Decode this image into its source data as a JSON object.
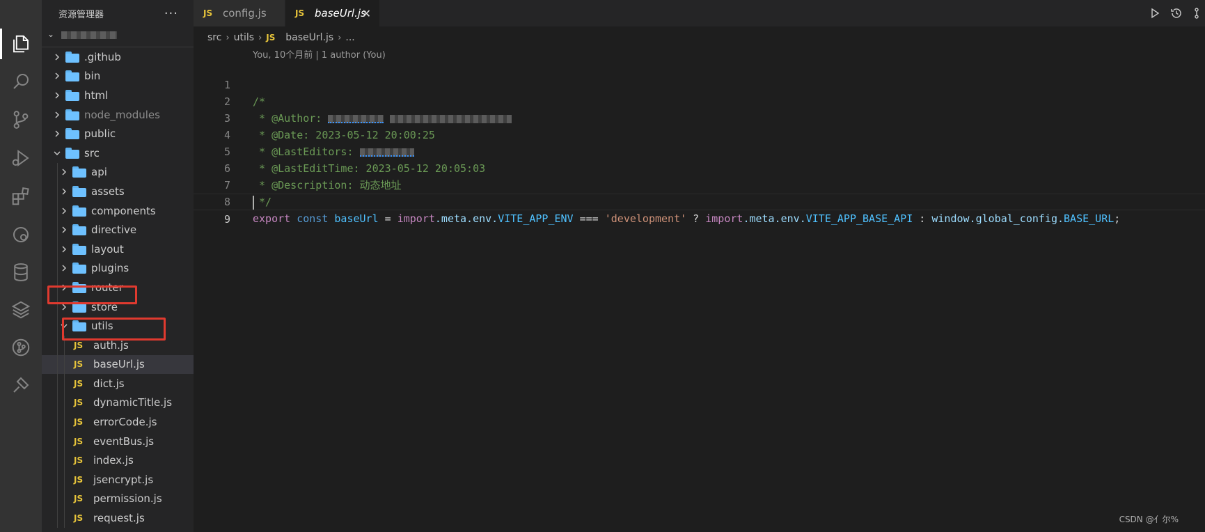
{
  "sidebar": {
    "title": "资源管理器",
    "more": "···",
    "items": [
      {
        "type": "folder",
        "label": ".github",
        "depth": 1,
        "open": false
      },
      {
        "type": "folder",
        "label": "bin",
        "depth": 1,
        "open": false
      },
      {
        "type": "folder",
        "label": "html",
        "depth": 1,
        "open": false
      },
      {
        "type": "folder",
        "label": "node_modules",
        "depth": 1,
        "open": false,
        "dim": true
      },
      {
        "type": "folder",
        "label": "public",
        "depth": 1,
        "open": false
      },
      {
        "type": "folder",
        "label": "src",
        "depth": 1,
        "open": true
      },
      {
        "type": "folder",
        "label": "api",
        "depth": 2,
        "open": false
      },
      {
        "type": "folder",
        "label": "assets",
        "depth": 2,
        "open": false
      },
      {
        "type": "folder",
        "label": "components",
        "depth": 2,
        "open": false
      },
      {
        "type": "folder",
        "label": "directive",
        "depth": 2,
        "open": false
      },
      {
        "type": "folder",
        "label": "layout",
        "depth": 2,
        "open": false
      },
      {
        "type": "folder",
        "label": "plugins",
        "depth": 2,
        "open": false
      },
      {
        "type": "folder",
        "label": "router",
        "depth": 2,
        "open": false
      },
      {
        "type": "folder",
        "label": "store",
        "depth": 2,
        "open": false
      },
      {
        "type": "folder",
        "label": "utils",
        "depth": 2,
        "open": true,
        "highlighted": true
      },
      {
        "type": "file",
        "label": "auth.js",
        "depth": 3
      },
      {
        "type": "file",
        "label": "baseUrl.js",
        "depth": 3,
        "selected": true,
        "highlighted": true
      },
      {
        "type": "file",
        "label": "dict.js",
        "depth": 3
      },
      {
        "type": "file",
        "label": "dynamicTitle.js",
        "depth": 3
      },
      {
        "type": "file",
        "label": "errorCode.js",
        "depth": 3
      },
      {
        "type": "file",
        "label": "eventBus.js",
        "depth": 3
      },
      {
        "type": "file",
        "label": "index.js",
        "depth": 3
      },
      {
        "type": "file",
        "label": "jsencrypt.js",
        "depth": 3
      },
      {
        "type": "file",
        "label": "permission.js",
        "depth": 3
      },
      {
        "type": "file",
        "label": "request.js",
        "depth": 3
      }
    ]
  },
  "tabs": [
    {
      "icon": "JS",
      "label": "config.js",
      "active": false
    },
    {
      "icon": "JS",
      "label": "baseUrl.js",
      "active": true,
      "close": "✕"
    }
  ],
  "breadcrumb": [
    "src",
    "utils",
    "JS",
    "baseUrl.js",
    "..."
  ],
  "blame": "You, 10个月前 | 1 author (You)",
  "code": {
    "line_numbers": [
      "1",
      "2",
      "3",
      "4",
      "5",
      "6",
      "7",
      "8",
      "9"
    ],
    "l1": "/*",
    "l2": " * @Author: ",
    "l3": " * @Date: 2023-05-12 20:00:25",
    "l4": " * @LastEditors: ",
    "l5": " * @LastEditTime: 2023-05-12 20:05:03",
    "l6": " * @Description: 动态地址",
    "l7": " */",
    "l8": {
      "export": "export",
      "const": "const",
      "name": "baseUrl",
      "eq": " = ",
      "import1": "import",
      "meta1": ".meta.env.",
      "env1": "VITE_APP_ENV",
      "cmp": " === ",
      "str": "'development'",
      "q": " ? ",
      "import2": "import",
      "meta2": ".meta.env.",
      "env2": "VITE_APP_BASE_API",
      "colon": " : ",
      "win": "window",
      "gc": ".global_config.",
      "base": "BASE_URL",
      "semi": ";"
    }
  },
  "watermark": "CSDN @亻尔%",
  "colors": {
    "accent": "#007acc",
    "highlight_box": "#e03a2f",
    "js_icon": "#e8c53b",
    "folder": "#6ec1ff"
  }
}
